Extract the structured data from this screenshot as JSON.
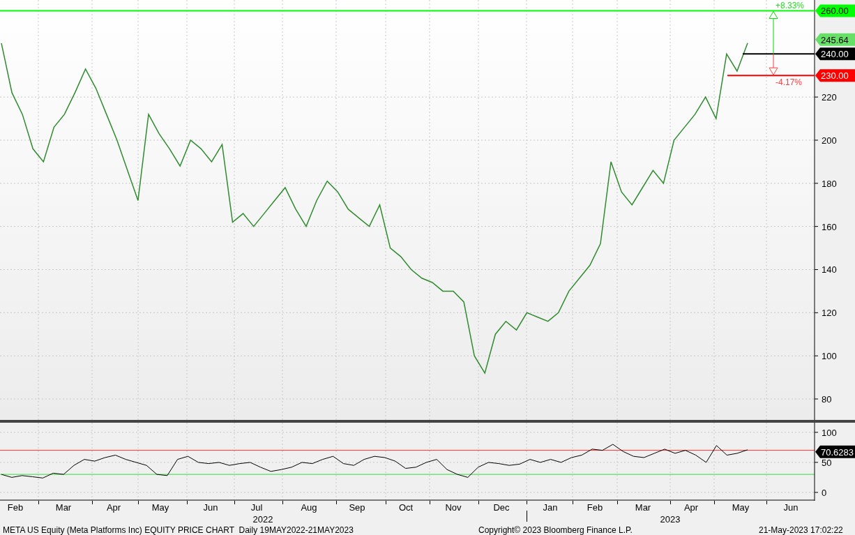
{
  "price_panel": {
    "chart_data": {
      "type": "line",
      "ylim": [
        69,
        265
      ],
      "yticks": [
        80,
        100,
        120,
        140,
        160,
        180,
        200,
        220
      ],
      "grid": true,
      "ref_lines": [
        {
          "axis": "y",
          "value": 260,
          "color": "#00ff00"
        }
      ],
      "series": [
        {
          "color": "#2e8b2e",
          "values": [
            245,
            222,
            212,
            196,
            190,
            206,
            212,
            222,
            233,
            224,
            212,
            200,
            186,
            172,
            212,
            203,
            196,
            188,
            200,
            196,
            190,
            198,
            162,
            166,
            160,
            166,
            172,
            178,
            168,
            160,
            172,
            181,
            176,
            168,
            164,
            160,
            170,
            150,
            146,
            140,
            136,
            134,
            130,
            130,
            125,
            100,
            92,
            110,
            116,
            112,
            120,
            118,
            116,
            120,
            130,
            136,
            142,
            152,
            190,
            176,
            170,
            178,
            186,
            180,
            200,
            206,
            212,
            220,
            210,
            240,
            232,
            245
          ]
        }
      ]
    },
    "levels": [
      {
        "label": "260.00",
        "color": "#00ff00",
        "kind": "target"
      },
      {
        "label": "245.64",
        "color": "#66e066",
        "kind": "last"
      },
      {
        "label": "240.00",
        "color": "#000000",
        "kind": "entry"
      },
      {
        "label": "230.00",
        "color": "#ff0000",
        "kind": "stop"
      }
    ],
    "range_measure": {
      "up_label": "+8.33%",
      "down_label": "-4.17%"
    }
  },
  "rsi_panel": {
    "chart_data": {
      "type": "line",
      "ylim": [
        -14,
        116
      ],
      "yticks": [
        0,
        50,
        100
      ],
      "grid": true,
      "ref_lines": [
        {
          "axis": "y",
          "value": 70,
          "color": "#ff3030"
        },
        {
          "axis": "y",
          "value": 30,
          "color": "#30dd30"
        }
      ],
      "series": [
        {
          "color": "#000000",
          "values": [
            30,
            25,
            28,
            26,
            24,
            32,
            30,
            45,
            55,
            52,
            58,
            62,
            55,
            50,
            45,
            30,
            28,
            55,
            60,
            50,
            48,
            50,
            45,
            48,
            50,
            42,
            35,
            38,
            42,
            50,
            48,
            55,
            60,
            48,
            45,
            55,
            60,
            58,
            52,
            40,
            42,
            50,
            55,
            38,
            30,
            25,
            42,
            50,
            48,
            45,
            47,
            55,
            50,
            55,
            50,
            58,
            62,
            72,
            70,
            80,
            68,
            60,
            58,
            65,
            72,
            65,
            70,
            62,
            50,
            78,
            62,
            65,
            71
          ]
        }
      ]
    },
    "value_label": "70.6283"
  },
  "x_axis": {
    "months": [
      "Feb",
      "Mar",
      "Apr",
      "May",
      "Jun",
      "Jul",
      "Aug",
      "Sep",
      "Oct",
      "Nov",
      "Dec",
      "Jan",
      "Feb",
      "Mar",
      "Apr",
      "May",
      "Jun"
    ],
    "years": [
      "2022",
      "2023"
    ]
  },
  "footer": {
    "description": "META US Equity (Meta Platforms Inc) EQUITY PRICE CHART  Daily 19MAY2022-21MAY2023",
    "copyright": "Copyright© 2023 Bloomberg Finance L.P.",
    "timestamp": "21-May-2023 17:02:22"
  }
}
